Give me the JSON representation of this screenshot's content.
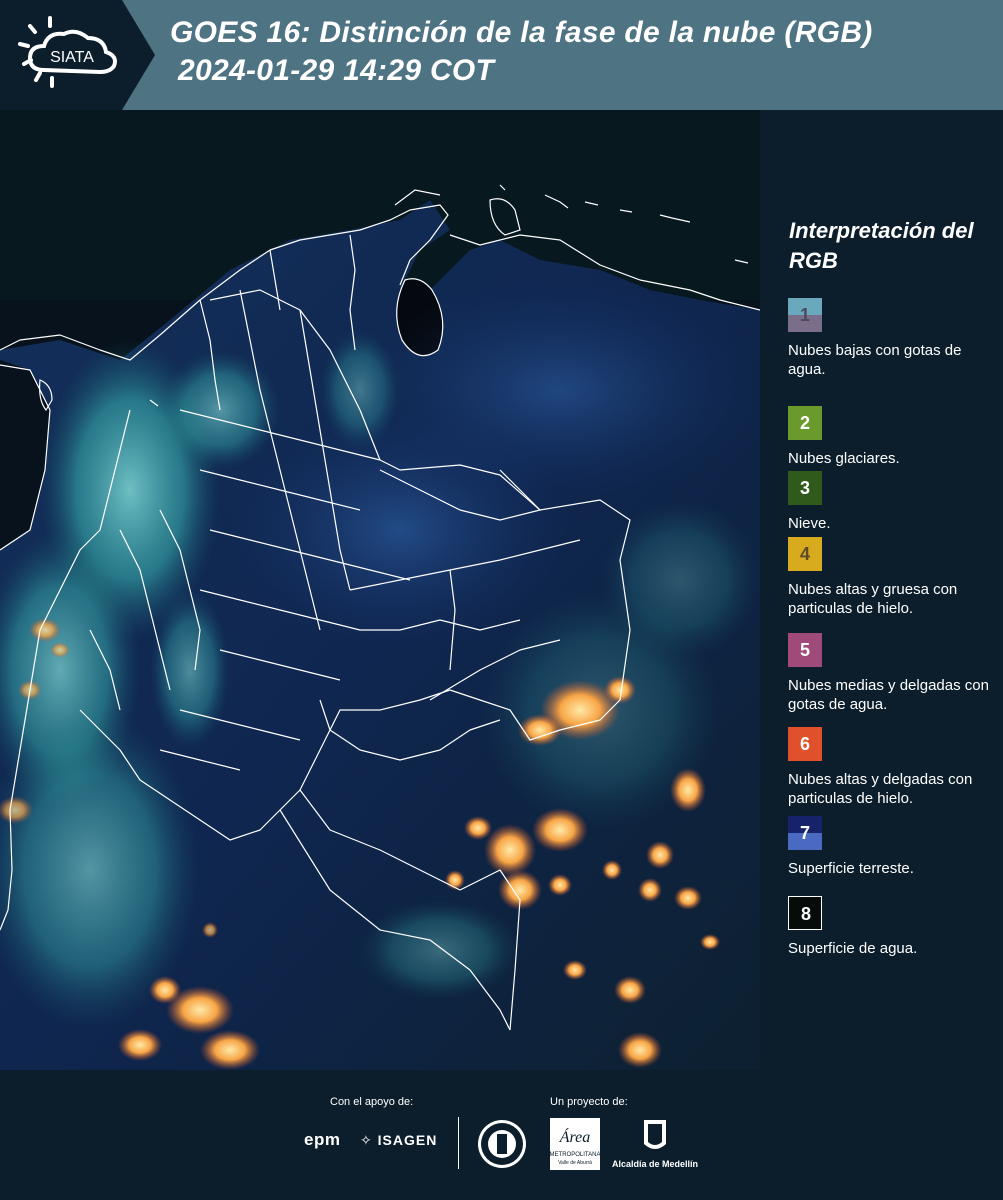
{
  "header": {
    "logo_text": "SIATA",
    "title_line1": "GOES 16: Distinción de la fase de la nube (RGB)",
    "title_line2": "2024-01-29 14:29 COT"
  },
  "legend": {
    "title": "Interpretación del RGB",
    "items": [
      {
        "num": "1",
        "label": "Nubes bajas con gotas de agua.",
        "color_top": "#6aa8be",
        "color_bottom": "#7a6e8a",
        "num_color": "#4a4a5a"
      },
      {
        "num": "2",
        "label": "Nubes glaciares.",
        "color": "#6a9a2c",
        "num_color": "#ffffff"
      },
      {
        "num": "3",
        "label": "Nieve.",
        "color": "#2f5a1c",
        "num_color": "#ffffff"
      },
      {
        "num": "4",
        "label": "Nubes altas y gruesa con particulas de hielo.",
        "color": "#d8aa1e",
        "num_color": "#5a4a2a"
      },
      {
        "num": "5",
        "label": "Nubes medias y delgadas con gotas de agua.",
        "color": "#a04a7a",
        "num_color": "#ffffff"
      },
      {
        "num": "6",
        "label": "Nubes altas y delgadas con particulas de hielo.",
        "color": "#e0502a",
        "num_color": "#ffffff"
      },
      {
        "num": "7",
        "label": "Superficie terreste.",
        "color_top": "#16236a",
        "color_bottom": "#4a6ac2",
        "num_color": "#ffffff"
      },
      {
        "num": "8",
        "label": "Superficie de agua.",
        "color": "#050c0a",
        "num_color": "#ffffff",
        "border": "#ffffff"
      }
    ]
  },
  "footer": {
    "support_label": "Con el apoyo de:",
    "project_label": "Un proyecto de:",
    "sponsor1": "epm",
    "sponsor2": "ISAGEN",
    "partner2_lines": [
      "Área",
      "METROPOLITANA",
      "Valle de Aburrá"
    ],
    "partner3": "Alcaldía de Medellín"
  }
}
